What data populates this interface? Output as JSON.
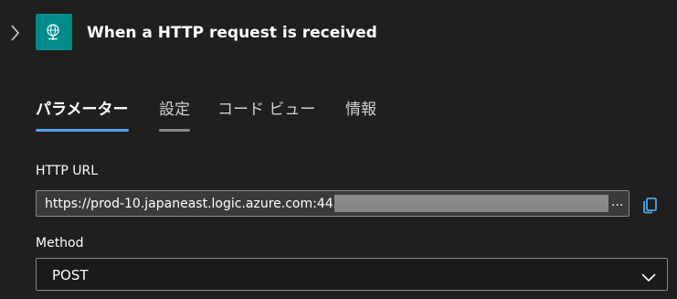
{
  "header": {
    "title": "When a HTTP request is received",
    "expand_icon": "chevron-right-icon",
    "trigger_icon": "globe-request-icon",
    "trigger_color": "#008b8b"
  },
  "tabs": [
    {
      "label": "パラメーター",
      "state": "active"
    },
    {
      "label": "設定",
      "state": "hover"
    },
    {
      "label": "コード ビュー",
      "state": "inactive"
    },
    {
      "label": "情報",
      "state": "inactive"
    }
  ],
  "http_url": {
    "label": "HTTP URL",
    "value": "https://prod-10.japaneast.logic.azure.com:443/\\",
    "truncation": "...",
    "copy_icon": "copy-icon"
  },
  "method": {
    "label": "Method",
    "value": "POST",
    "dropdown_icon": "chevron-down-icon"
  },
  "colors": {
    "background": "#201f1e",
    "accent": "#4ea5f0",
    "input_background": "#3b3a39",
    "border": "#8a8886"
  }
}
